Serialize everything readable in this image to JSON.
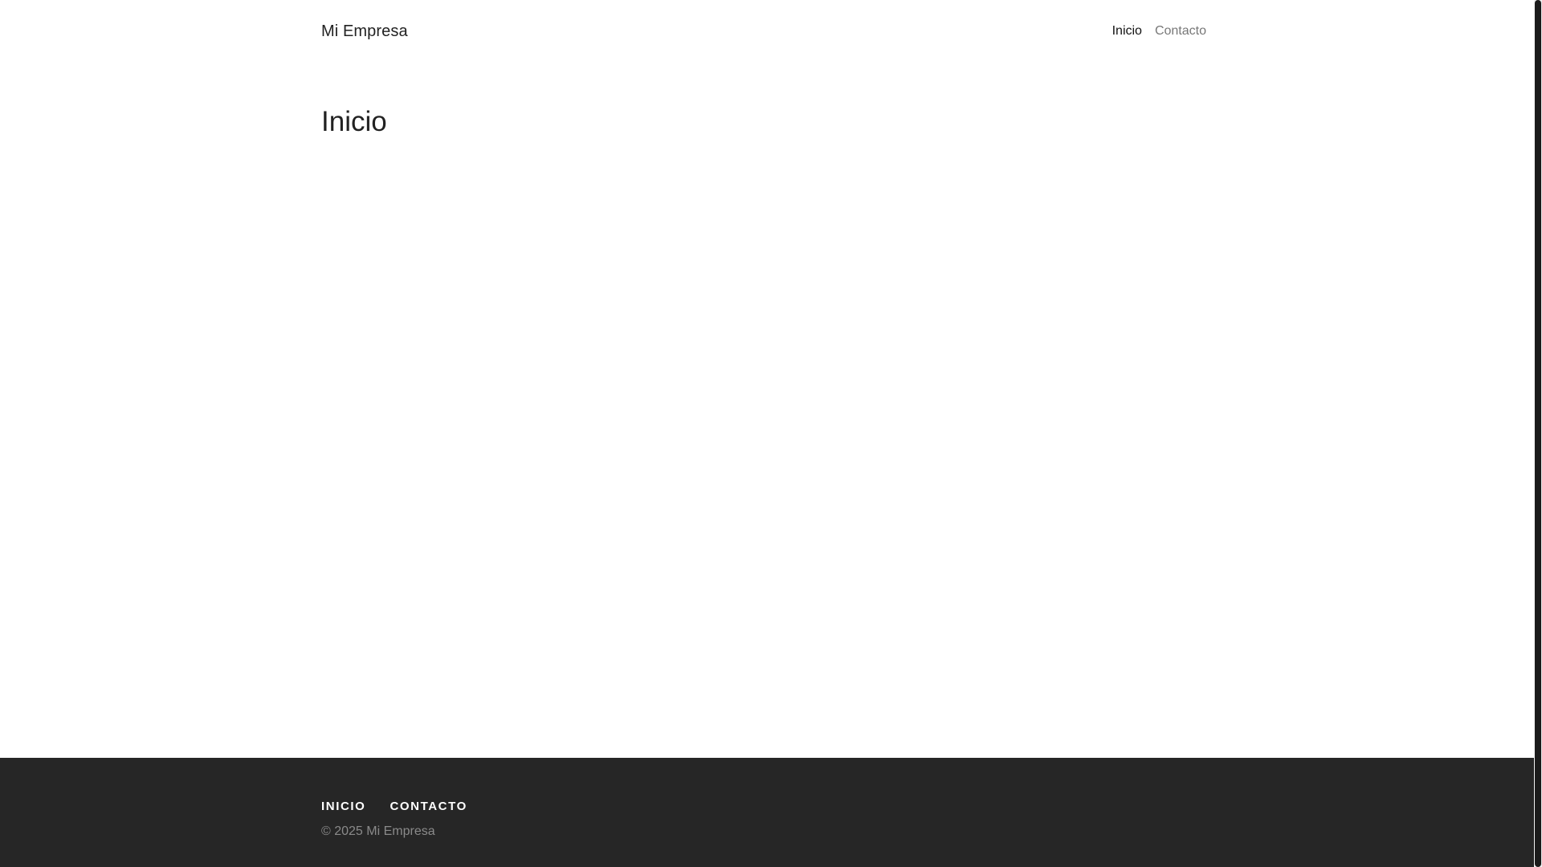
{
  "header": {
    "brand": "Mi Empresa",
    "nav": [
      {
        "label": "Inicio",
        "active": true
      },
      {
        "label": "Contacto",
        "active": false
      }
    ]
  },
  "main": {
    "title": "Inicio"
  },
  "footer": {
    "nav": [
      {
        "label": "INICIO"
      },
      {
        "label": "CONTACTO"
      }
    ],
    "copyright": "© 2025 Mi Empresa"
  },
  "colors": {
    "footer_bg": "#262626",
    "text_primary": "#222222",
    "text_muted": "#777777"
  }
}
